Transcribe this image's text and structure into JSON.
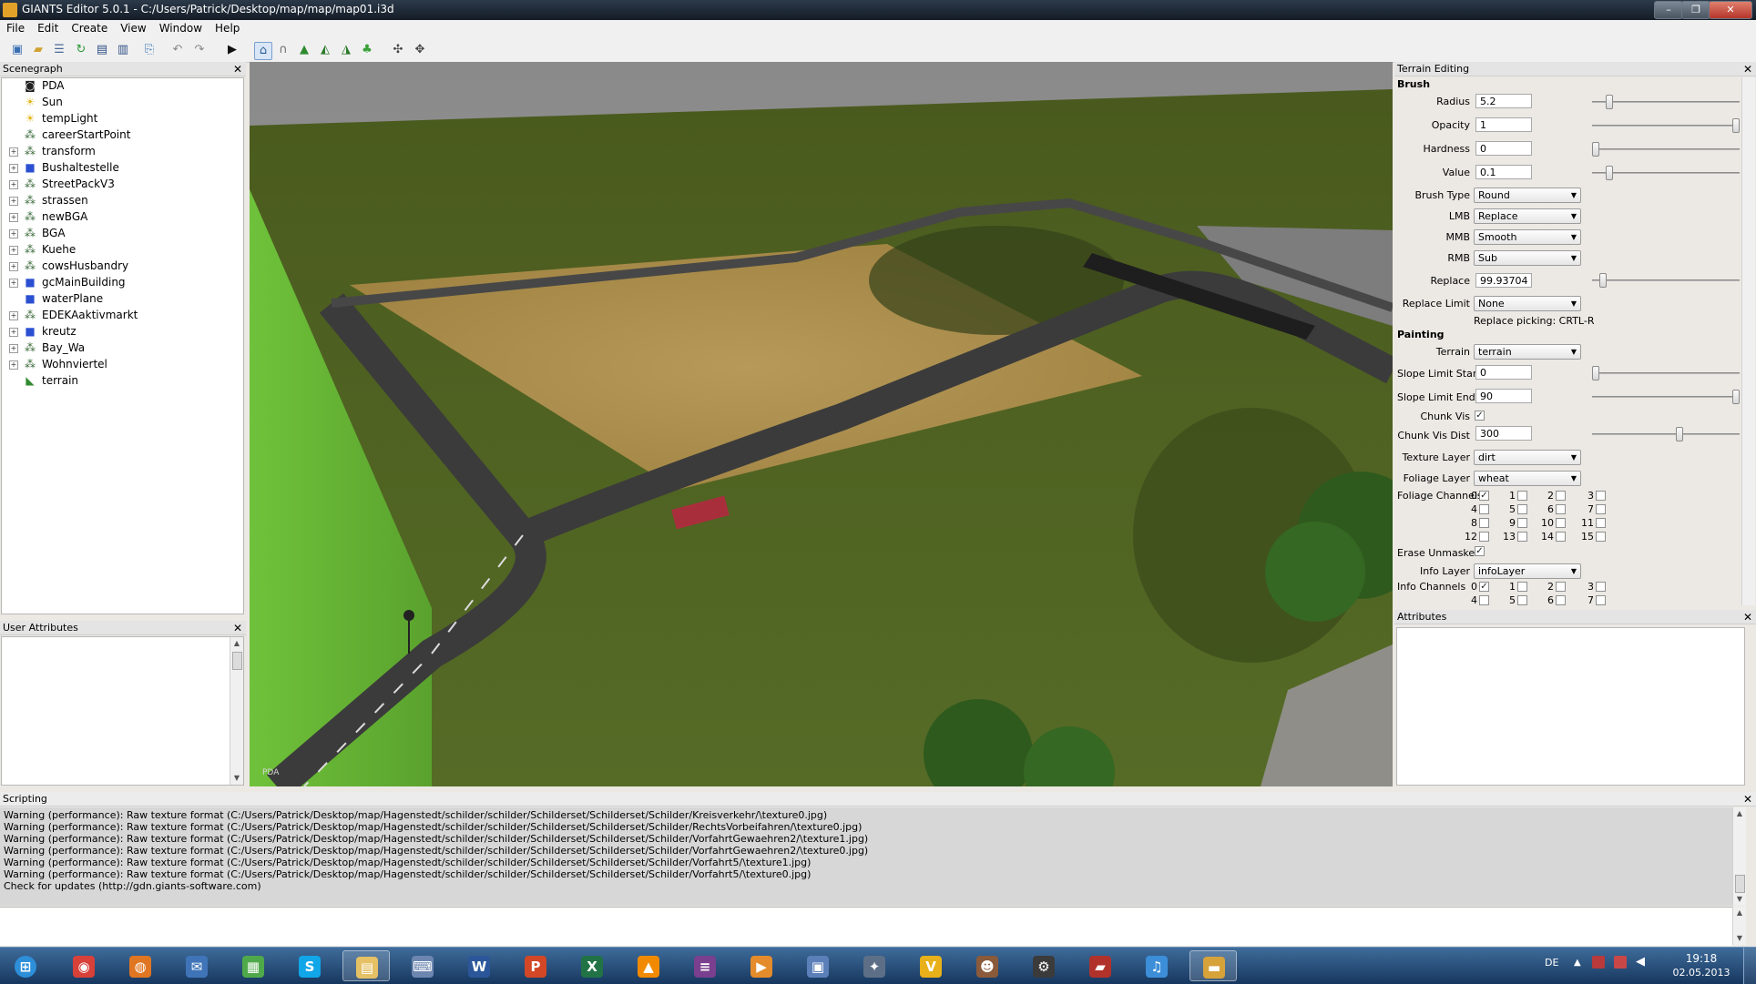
{
  "window": {
    "title": "GIANTS Editor 5.0.1 - C:/Users/Patrick/Desktop/map/map/map01.i3d",
    "controls": [
      "–",
      "❐",
      "✕"
    ]
  },
  "menu": [
    "File",
    "Edit",
    "Create",
    "View",
    "Window",
    "Help"
  ],
  "toolbar": {
    "icons": [
      "new-icon",
      "open-icon",
      "list-icon",
      "refresh-icon",
      "save-icon",
      "save-all-icon",
      "import-icon",
      "undo-icon",
      "redo-icon",
      "play-icon",
      "select-mode-icon",
      "move-mode-icon",
      "terrain-sculpt-icon",
      "terrain-paint-icon",
      "foliage-paint-icon",
      "plant-icon",
      "network-icon",
      "network-settings-icon"
    ]
  },
  "scenegraph": {
    "title": "Scenegraph",
    "nodes": [
      {
        "label": "PDA",
        "icon": "camera-icon",
        "expandable": false
      },
      {
        "label": "Sun",
        "icon": "light-icon",
        "expandable": false
      },
      {
        "label": "tempLight",
        "icon": "light-icon",
        "expandable": false
      },
      {
        "label": "careerStartPoint",
        "icon": "transform-icon",
        "expandable": false
      },
      {
        "label": "transform",
        "icon": "transform-icon",
        "expandable": true
      },
      {
        "label": "Bushaltestelle",
        "icon": "shape-icon",
        "expandable": true
      },
      {
        "label": "StreetPackV3",
        "icon": "transform-icon",
        "expandable": true
      },
      {
        "label": "strassen",
        "icon": "transform-icon",
        "expandable": true
      },
      {
        "label": "newBGA",
        "icon": "transform-icon",
        "expandable": true
      },
      {
        "label": "BGA",
        "icon": "transform-icon",
        "expandable": true
      },
      {
        "label": "Kuehe",
        "icon": "transform-icon",
        "expandable": true
      },
      {
        "label": "cowsHusbandry",
        "icon": "transform-icon",
        "expandable": true
      },
      {
        "label": "gcMainBuilding",
        "icon": "shape-icon",
        "expandable": true
      },
      {
        "label": "waterPlane",
        "icon": "shape-icon",
        "expandable": false
      },
      {
        "label": "EDEKAaktivmarkt",
        "icon": "transform-icon",
        "expandable": true
      },
      {
        "label": "kreutz",
        "icon": "shape-icon",
        "expandable": true
      },
      {
        "label": "Bay_Wa",
        "icon": "transform-icon",
        "expandable": true
      },
      {
        "label": "Wohnviertel",
        "icon": "transform-icon",
        "expandable": true
      },
      {
        "label": "terrain",
        "icon": "terrain-icon",
        "expandable": false
      }
    ]
  },
  "user_attributes": {
    "title": "User Attributes"
  },
  "viewport": {
    "camera_label": "PDA"
  },
  "terrain_editing": {
    "title": "Terrain Editing",
    "brush_header": "Brush",
    "radius": {
      "label": "Radius",
      "value": "5.2",
      "slider": 0.1
    },
    "opacity": {
      "label": "Opacity",
      "value": "1",
      "slider": 1.0
    },
    "hardness": {
      "label": "Hardness",
      "value": "0",
      "slider": 0.0
    },
    "value": {
      "label": "Value",
      "value": "0.1",
      "slider": 0.1
    },
    "brush_type": {
      "label": "Brush Type",
      "value": "Round"
    },
    "lmb": {
      "label": "LMB",
      "value": "Replace"
    },
    "mmb": {
      "label": "MMB",
      "value": "Smooth"
    },
    "rmb": {
      "label": "RMB",
      "value": "Sub"
    },
    "replace": {
      "label": "Replace",
      "value": "99.93704",
      "slider": 0.05
    },
    "replace_limit": {
      "label": "Replace Limit",
      "value": "None"
    },
    "replace_picking": "Replace picking: CRTL-R",
    "painting_header": "Painting",
    "terrain": {
      "label": "Terrain",
      "value": "terrain"
    },
    "slope_limit_start": {
      "label": "Slope Limit Start",
      "value": "0",
      "slider": 0.0
    },
    "slope_limit_end": {
      "label": "Slope Limit End",
      "value": "90",
      "slider": 1.0
    },
    "chunk_vis": {
      "label": "Chunk Vis",
      "checked": true
    },
    "chunk_vis_dist": {
      "label": "Chunk Vis Dist",
      "value": "300",
      "slider": 0.6
    },
    "texture_layer": {
      "label": "Texture Layer",
      "value": "dirt"
    },
    "foliage_layer": {
      "label": "Foliage Layer",
      "value": "wheat"
    },
    "foliage_channels": {
      "label": "Foliage Channels",
      "channels": [
        {
          "n": "0",
          "checked": true
        },
        {
          "n": "1",
          "checked": false
        },
        {
          "n": "2",
          "checked": false
        },
        {
          "n": "3",
          "checked": false
        },
        {
          "n": "4",
          "checked": false
        },
        {
          "n": "5",
          "checked": false
        },
        {
          "n": "6",
          "checked": false
        },
        {
          "n": "7",
          "checked": false
        },
        {
          "n": "8",
          "checked": false
        },
        {
          "n": "9",
          "checked": false
        },
        {
          "n": "10",
          "checked": false
        },
        {
          "n": "11",
          "checked": false
        },
        {
          "n": "12",
          "checked": false
        },
        {
          "n": "13",
          "checked": false
        },
        {
          "n": "14",
          "checked": false
        },
        {
          "n": "15",
          "checked": false
        }
      ]
    },
    "erase_unmasked": {
      "label": "Erase Unmasked",
      "checked": true
    },
    "info_layer": {
      "label": "Info Layer",
      "value": "infoLayer"
    },
    "info_channels": {
      "label": "Info Channels",
      "channels": [
        {
          "n": "0",
          "checked": true
        },
        {
          "n": "1",
          "checked": false
        },
        {
          "n": "2",
          "checked": false
        },
        {
          "n": "3",
          "checked": false
        },
        {
          "n": "4",
          "checked": false
        },
        {
          "n": "5",
          "checked": false
        },
        {
          "n": "6",
          "checked": false
        },
        {
          "n": "7",
          "checked": false
        }
      ]
    }
  },
  "attributes": {
    "title": "Attributes"
  },
  "scripting": {
    "title": "Scripting",
    "lines": [
      "Warning (performance): Raw texture format (C:/Users/Patrick/Desktop/map/Hagenstedt/schilder/schilder/Schilderset/Schilderset/Schilder/Kreisverkehr/\\texture0.jpg)",
      "Warning (performance): Raw texture format (C:/Users/Patrick/Desktop/map/Hagenstedt/schilder/schilder/Schilderset/Schilderset/Schilder/RechtsVorbeifahren/\\texture0.jpg)",
      "Warning (performance): Raw texture format (C:/Users/Patrick/Desktop/map/Hagenstedt/schilder/schilder/Schilderset/Schilderset/Schilder/VorfahrtGewaehren2/\\texture1.jpg)",
      "Warning (performance): Raw texture format (C:/Users/Patrick/Desktop/map/Hagenstedt/schilder/schilder/Schilderset/Schilderset/Schilder/VorfahrtGewaehren2/\\texture0.jpg)",
      "Warning (performance): Raw texture format (C:/Users/Patrick/Desktop/map/Hagenstedt/schilder/schilder/Schilderset/Schilderset/Schilder/Vorfahrt5/\\texture1.jpg)",
      "Warning (performance): Raw texture format (C:/Users/Patrick/Desktop/map/Hagenstedt/schilder/schilder/Schilderset/Schilderset/Schilder/Vorfahrt5/\\texture0.jpg)",
      "Check for updates (http://gdn.giants-software.com)"
    ]
  },
  "taskbar": {
    "apps": [
      {
        "name": "start-orb-icon",
        "color": "#2e8fd9",
        "glyph": "⊞"
      },
      {
        "name": "chrome-icon",
        "color": "#d8403a",
        "glyph": "◉"
      },
      {
        "name": "firefox-icon",
        "color": "#e07622",
        "glyph": "◍"
      },
      {
        "name": "thunderbird-icon",
        "color": "#3f74b8",
        "glyph": "✉"
      },
      {
        "name": "media-center-icon",
        "color": "#4fa94a",
        "glyph": "▦"
      },
      {
        "name": "skype-icon",
        "color": "#10a6e8",
        "glyph": "S"
      },
      {
        "name": "explorer-icon",
        "color": "#e5c064",
        "glyph": "▤"
      },
      {
        "name": "network-app-icon",
        "color": "#6c86b0",
        "glyph": "⌨"
      },
      {
        "name": "word-icon",
        "color": "#2b579a",
        "glyph": "W"
      },
      {
        "name": "powerpoint-icon",
        "color": "#d24726",
        "glyph": "P"
      },
      {
        "name": "excel-icon",
        "color": "#217346",
        "glyph": "X"
      },
      {
        "name": "vlc-icon",
        "color": "#f18a00",
        "glyph": "▲"
      },
      {
        "name": "winrar-icon",
        "color": "#7a3f8e",
        "glyph": "≡"
      },
      {
        "name": "media-player-icon",
        "color": "#e48b2b",
        "glyph": "▶"
      },
      {
        "name": "remote-desktop-icon",
        "color": "#5b7fb8",
        "glyph": "▣"
      },
      {
        "name": "steam-icon",
        "color": "#5d6f86",
        "glyph": "✦"
      },
      {
        "name": "v-app-icon",
        "color": "#e8b019",
        "glyph": "V"
      },
      {
        "name": "game-character-icon",
        "color": "#8a5a3a",
        "glyph": "☻"
      },
      {
        "name": "tractor-icon",
        "color": "#3b3b3b",
        "glyph": "⚙"
      },
      {
        "name": "farming-sim-icon",
        "color": "#b0322a",
        "glyph": "▰"
      },
      {
        "name": "itunes-icon",
        "color": "#3c8ed8",
        "glyph": "♫"
      },
      {
        "name": "giants-editor-icon",
        "color": "#d7a23a",
        "glyph": "▬"
      }
    ],
    "language": "DE",
    "time": "19:18",
    "date": "02.05.2013"
  }
}
